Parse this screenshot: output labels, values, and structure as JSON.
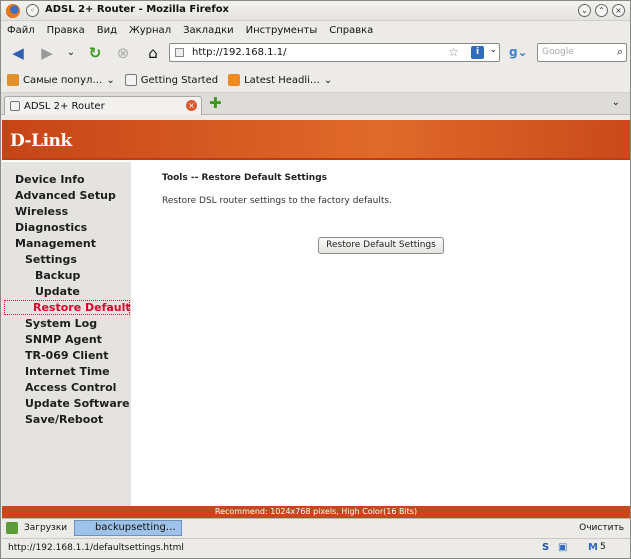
{
  "window": {
    "title": "ADSL 2+ Router - Mozilla Firefox"
  },
  "menu": [
    "Файл",
    "Правка",
    "Вид",
    "Журнал",
    "Закладки",
    "Инструменты",
    "Справка"
  ],
  "nav": {
    "url": "http://192.168.1.1/",
    "search_placeholder": "Google"
  },
  "bookmarks": [
    "Самые попул…",
    "Getting Started",
    "Latest Headli…"
  ],
  "tab": {
    "label": "ADSL 2+ Router"
  },
  "banner": {
    "logo": "D-Link"
  },
  "sidebar": {
    "items": [
      {
        "label": "Device Info"
      },
      {
        "label": "Advanced Setup"
      },
      {
        "label": "Wireless"
      },
      {
        "label": "Diagnostics"
      },
      {
        "label": "Management"
      },
      {
        "label": "Settings"
      },
      {
        "label": "Backup"
      },
      {
        "label": "Update"
      },
      {
        "label": "Restore Default"
      },
      {
        "label": "System Log"
      },
      {
        "label": "SNMP Agent"
      },
      {
        "label": "TR-069 Client"
      },
      {
        "label": "Internet Time"
      },
      {
        "label": "Access Control"
      },
      {
        "label": "Update Software"
      },
      {
        "label": "Save/Reboot"
      }
    ],
    "selected": "Restore Default"
  },
  "main": {
    "title": "Tools -- Restore Default Settings",
    "description": "Restore DSL router settings to the factory defaults.",
    "button": "Restore Default Settings"
  },
  "footer": {
    "text": "Recommend: 1024x768 pixels, High Color(16 Bits)"
  },
  "downloads": {
    "label": "Загрузки",
    "item": "backupsetting…",
    "clear": "Очистить"
  },
  "status": {
    "url": "http://192.168.1.1/defaultsettings.html",
    "mail_count": "5"
  },
  "colors": {
    "brand": "#c8461c",
    "selected": "#d8002b"
  }
}
